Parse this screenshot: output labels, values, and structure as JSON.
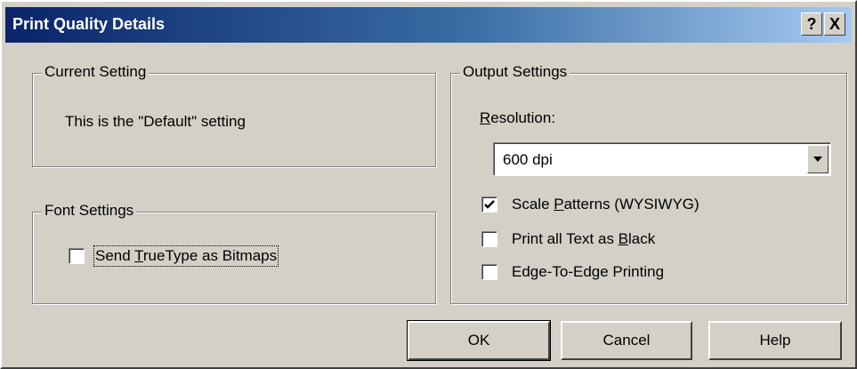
{
  "window": {
    "title": "Print Quality Details",
    "help_glyph": "?",
    "close_glyph": "X"
  },
  "current_setting": {
    "legend": "Current Setting",
    "text": "This is the \"Default\" setting"
  },
  "font_settings": {
    "legend": "Font Settings",
    "send_truetype": {
      "label_prefix": "Send ",
      "mnemonic": "T",
      "label_suffix": "rueType as Bitmaps",
      "checked": false
    }
  },
  "output_settings": {
    "legend": "Output Settings",
    "resolution": {
      "label_mnemonic": "R",
      "label_rest": "esolution:",
      "value": "600 dpi"
    },
    "scale_patterns": {
      "label_prefix": "Scale ",
      "mnemonic": "P",
      "label_suffix": "atterns (WYSIWYG)",
      "checked": true
    },
    "print_black": {
      "label_prefix": "Print all Text as ",
      "mnemonic": "B",
      "label_suffix": "lack",
      "checked": false
    },
    "edge_to_edge": {
      "label": "Edge-To-Edge Printing",
      "checked": false
    }
  },
  "buttons": {
    "ok": "OK",
    "cancel": "Cancel",
    "help": "Help"
  }
}
